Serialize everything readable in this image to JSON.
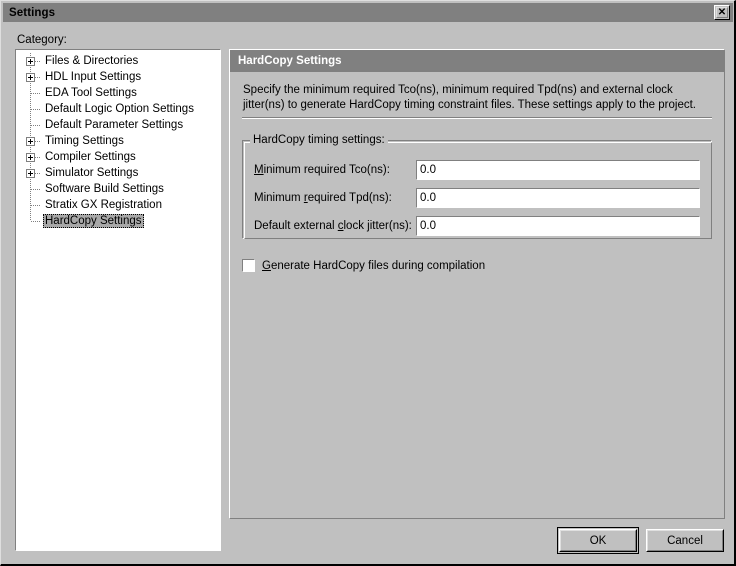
{
  "window": {
    "title": "Settings",
    "close_icon": "close-icon",
    "close_glyph": "✕"
  },
  "sidebar": {
    "label": "Category:",
    "items": [
      {
        "label": "Files & Directories",
        "expandable": true,
        "selected": false
      },
      {
        "label": "HDL Input Settings",
        "expandable": true,
        "selected": false
      },
      {
        "label": "EDA Tool Settings",
        "expandable": false,
        "selected": false
      },
      {
        "label": "Default Logic Option Settings",
        "expandable": false,
        "selected": false
      },
      {
        "label": "Default Parameter Settings",
        "expandable": false,
        "selected": false
      },
      {
        "label": "Timing Settings",
        "expandable": true,
        "selected": false
      },
      {
        "label": "Compiler Settings",
        "expandable": true,
        "selected": false
      },
      {
        "label": "Simulator Settings",
        "expandable": true,
        "selected": false
      },
      {
        "label": "Software Build Settings",
        "expandable": false,
        "selected": false
      },
      {
        "label": "Stratix GX Registration",
        "expandable": false,
        "selected": false
      },
      {
        "label": "HardCopy Settings",
        "expandable": false,
        "selected": true
      }
    ]
  },
  "panel": {
    "header": "HardCopy Settings",
    "description": "Specify the minimum required Tco(ns), minimum required Tpd(ns) and external clock jitter(ns) to generate HardCopy timing constraint files. These settings apply to the project.",
    "group": {
      "title": "HardCopy timing settings:",
      "fields": [
        {
          "label_pre": "",
          "label_mnemonic": "M",
          "label_post": "inimum required Tco(ns):",
          "label_full": "Minimum required Tco(ns):",
          "value": "0.0"
        },
        {
          "label_pre": "Minimum ",
          "label_mnemonic": "r",
          "label_post": "equired Tpd(ns):",
          "label_full": "Minimum required Tpd(ns):",
          "value": "0.0"
        },
        {
          "label_pre": "Default external ",
          "label_mnemonic": "c",
          "label_post": "lock jitter(ns):",
          "label_full": "Default external clock jitter(ns):",
          "value": "0.0"
        }
      ]
    },
    "checkbox": {
      "label_pre": "",
      "label_mnemonic": "G",
      "label_post": "enerate HardCopy files during compilation",
      "label_full": "Generate HardCopy files during compilation",
      "checked": false
    }
  },
  "buttons": {
    "ok": "OK",
    "cancel": "Cancel"
  },
  "colors": {
    "face": "#c0c0c0",
    "titlebar": "#808080",
    "header_banner": "#808080",
    "header_text": "#ffffff",
    "selection": "#a8a8a8",
    "field_bg": "#ffffff"
  }
}
